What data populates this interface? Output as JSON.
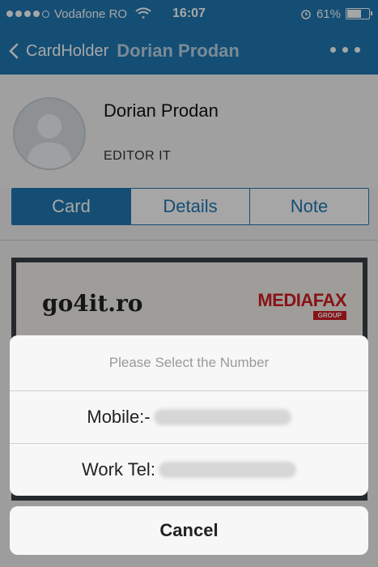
{
  "status_bar": {
    "carrier": "Vodafone RO",
    "time": "16:07",
    "battery_percent": "61%",
    "battery_level": 0.61,
    "signal_bars": 4,
    "wifi_icon": "wifi-icon",
    "alarm_icon": "alarm-icon"
  },
  "nav": {
    "back_label": "CardHolder",
    "title": "Dorian Prodan",
    "more_icon": "more-dots-icon"
  },
  "profile": {
    "name": "Dorian Prodan",
    "role": "EDITOR IT",
    "avatar_icon": "avatar-placeholder-icon"
  },
  "tabs": [
    {
      "label": "Card",
      "active": true
    },
    {
      "label": "Details",
      "active": false
    },
    {
      "label": "Note",
      "active": false
    }
  ],
  "card_image": {
    "logo_left": "go4it.ro",
    "logo_right": "MEDIAFAX",
    "logo_right_sub": "GROUP"
  },
  "action_sheet": {
    "title": "Please Select the Number",
    "options": [
      {
        "label": "Mobile:-"
      },
      {
        "label": "Work Tel:"
      }
    ],
    "cancel_label": "Cancel"
  },
  "colors": {
    "accent": "#1f79b2",
    "brand_red": "#d11c24"
  }
}
